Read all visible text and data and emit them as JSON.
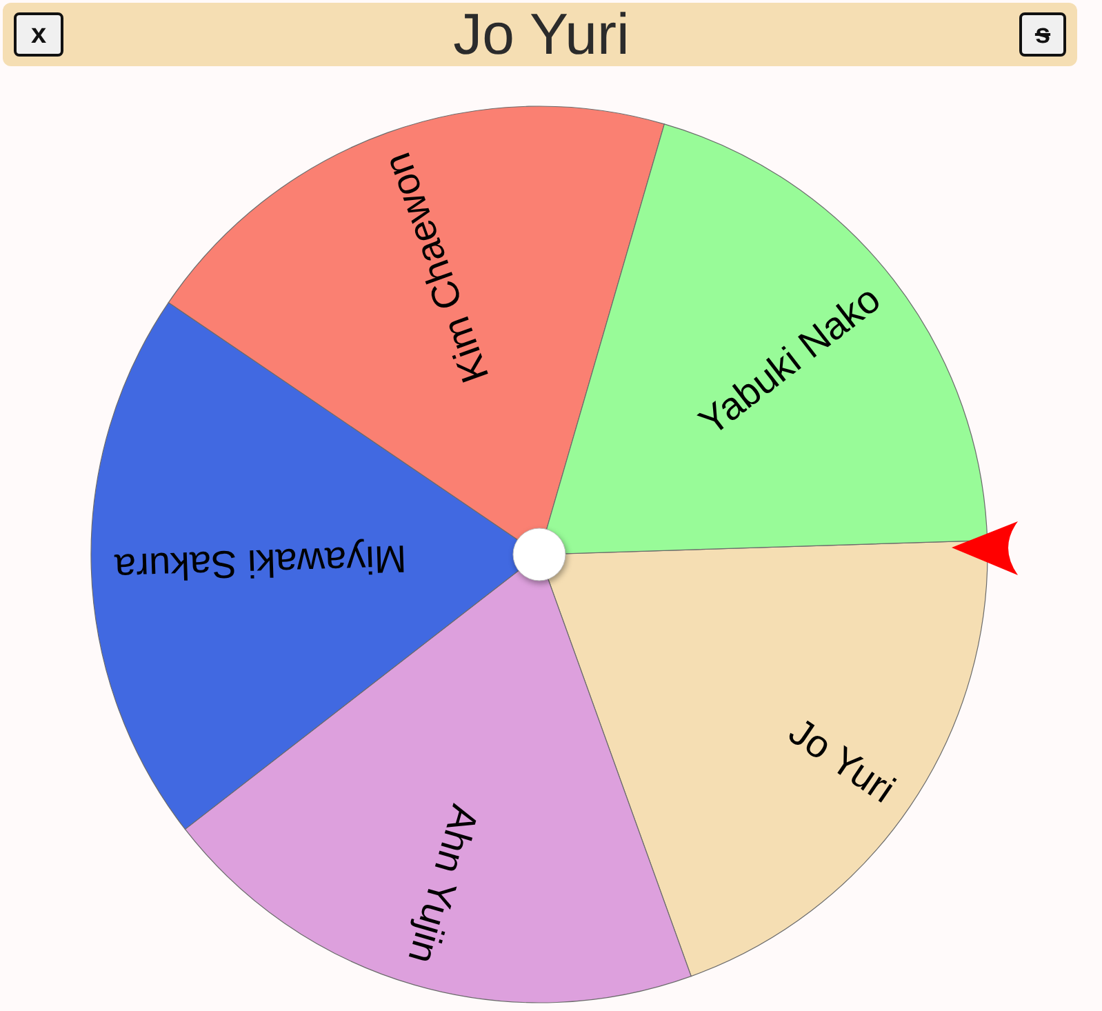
{
  "header": {
    "close_button": "x",
    "title": "Jo Yuri",
    "s_button": "s"
  },
  "wheel": {
    "segments": [
      {
        "label": "Jo Yuri",
        "color": "#f5deb3"
      },
      {
        "label": "Ahn Yujin",
        "color": "#dda0dd"
      },
      {
        "label": "Miyawaki Sakura",
        "color": "#4169e1"
      },
      {
        "label": "Kim Chaewon",
        "color": "#fa8072"
      },
      {
        "label": "Yabuki Nako",
        "color": "#98fb98"
      }
    ]
  }
}
